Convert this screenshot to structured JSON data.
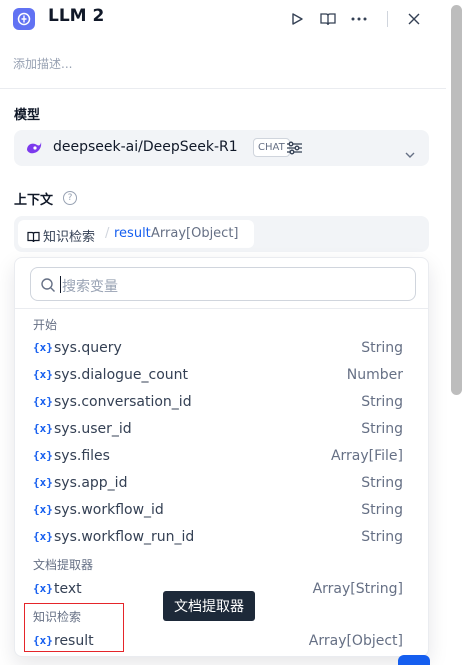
{
  "header": {
    "title": "LLM 2",
    "description_placeholder": "添加描述...",
    "icons": [
      "run-icon",
      "book-icon",
      "more-icon",
      "close-icon"
    ]
  },
  "model": {
    "section_label": "模型",
    "name": "deepseek-ai/DeepSeek-R1",
    "badge": "CHAT"
  },
  "context": {
    "section_label": "上下文",
    "chip": {
      "node": "知识检索",
      "separator": "/",
      "variable": "result",
      "type": "Array[Object]"
    }
  },
  "dropdown": {
    "search_placeholder": "搜索变量",
    "groups": [
      {
        "title": "开始",
        "items": [
          {
            "name": "sys.query",
            "type": "String"
          },
          {
            "name": "sys.dialogue_count",
            "type": "Number"
          },
          {
            "name": "sys.conversation_id",
            "type": "String"
          },
          {
            "name": "sys.user_id",
            "type": "String"
          },
          {
            "name": "sys.files",
            "type": "Array[File]"
          },
          {
            "name": "sys.app_id",
            "type": "String"
          },
          {
            "name": "sys.workflow_id",
            "type": "String"
          },
          {
            "name": "sys.workflow_run_id",
            "type": "String"
          }
        ]
      },
      {
        "title": "文档提取器",
        "items": [
          {
            "name": "text",
            "type": "Array[String]"
          }
        ]
      },
      {
        "title": "知识检索",
        "items": [
          {
            "name": "result",
            "type": "Array[Object]"
          }
        ]
      }
    ],
    "var_icon": "{x}"
  },
  "tooltip": "文档提取器",
  "colors": {
    "accent": "#155eef",
    "node_icon": "#6172f3",
    "highlight": "#e5252a"
  }
}
